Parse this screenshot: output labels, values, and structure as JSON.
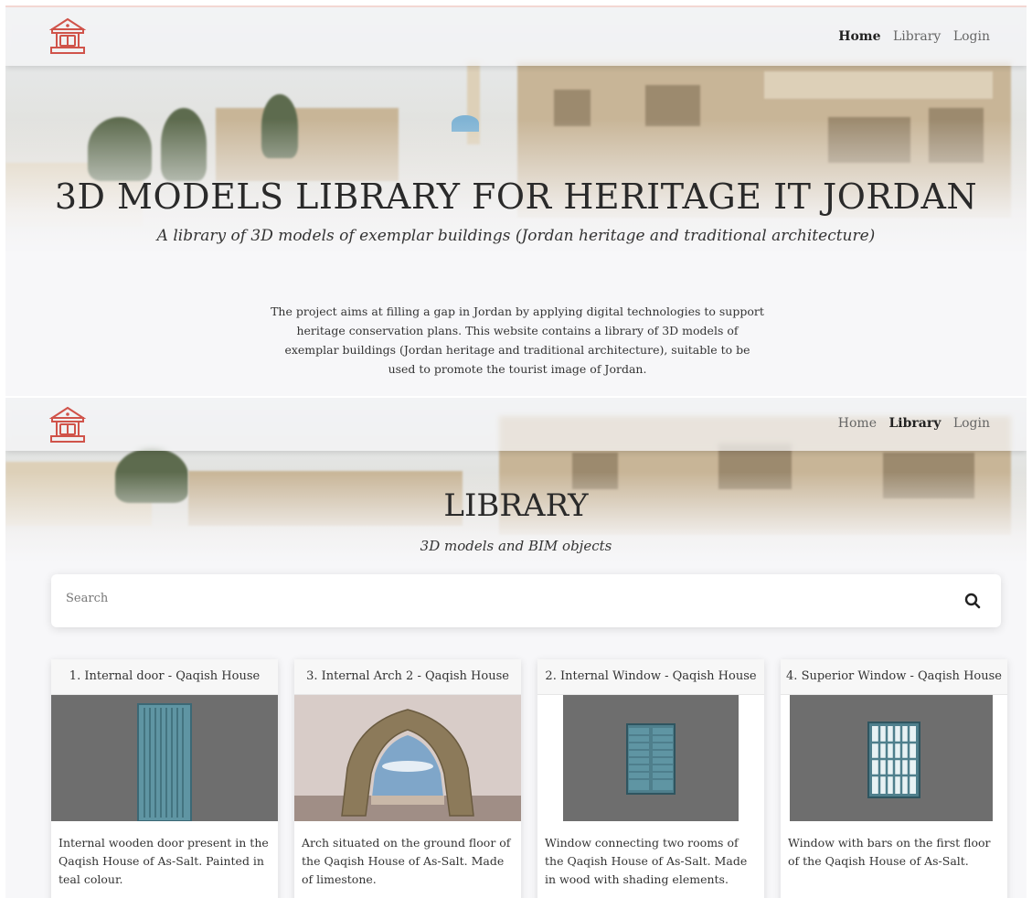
{
  "top": {
    "nav": {
      "home": "Home",
      "library": "Library",
      "login": "Login"
    },
    "title": "3D MODELS LIBRARY FOR HERITAGE IT JORDAN",
    "subtitle": "A library of 3D models of exemplar buildings (Jordan heritage and traditional architecture)",
    "description": "The project aims at filling a gap in Jordan by applying digital technologies to support heritage conservation plans. This website contains a library of 3D models of exemplar buildings (Jordan heritage and traditional architecture), suitable to be used to promote the tourist image of Jordan."
  },
  "bottom": {
    "nav": {
      "home": "Home",
      "library": "Library",
      "login": "Login"
    },
    "title": "LIBRARY",
    "subtitle": "3D models and BIM objects",
    "search": {
      "placeholder": "Search"
    },
    "cards": [
      {
        "title": "1. Internal door - Qaqish House",
        "description": "Internal wooden door present in the Qaqish House of As-Salt. Painted in teal colour."
      },
      {
        "title": "3. Internal Arch 2 - Qaqish House",
        "description": "Arch situated on the ground floor of the Qaqish House of As-Salt. Made of limestone."
      },
      {
        "title": "2. Internal Window - Qaqish House",
        "description": "Window connecting two rooms of the Qaqish House of As-Salt. Made in wood with shading elements."
      },
      {
        "title": "4. Superior Window - Qaqish House",
        "description": "Window with bars on the first floor of the Qaqish House of As-Salt."
      }
    ]
  },
  "colors": {
    "logo": "#d0534a",
    "teal": "#5f95a3",
    "model_bg": "#6e6e6e"
  },
  "icons": {
    "logo": "museum-logo-icon",
    "search": "search-icon"
  }
}
